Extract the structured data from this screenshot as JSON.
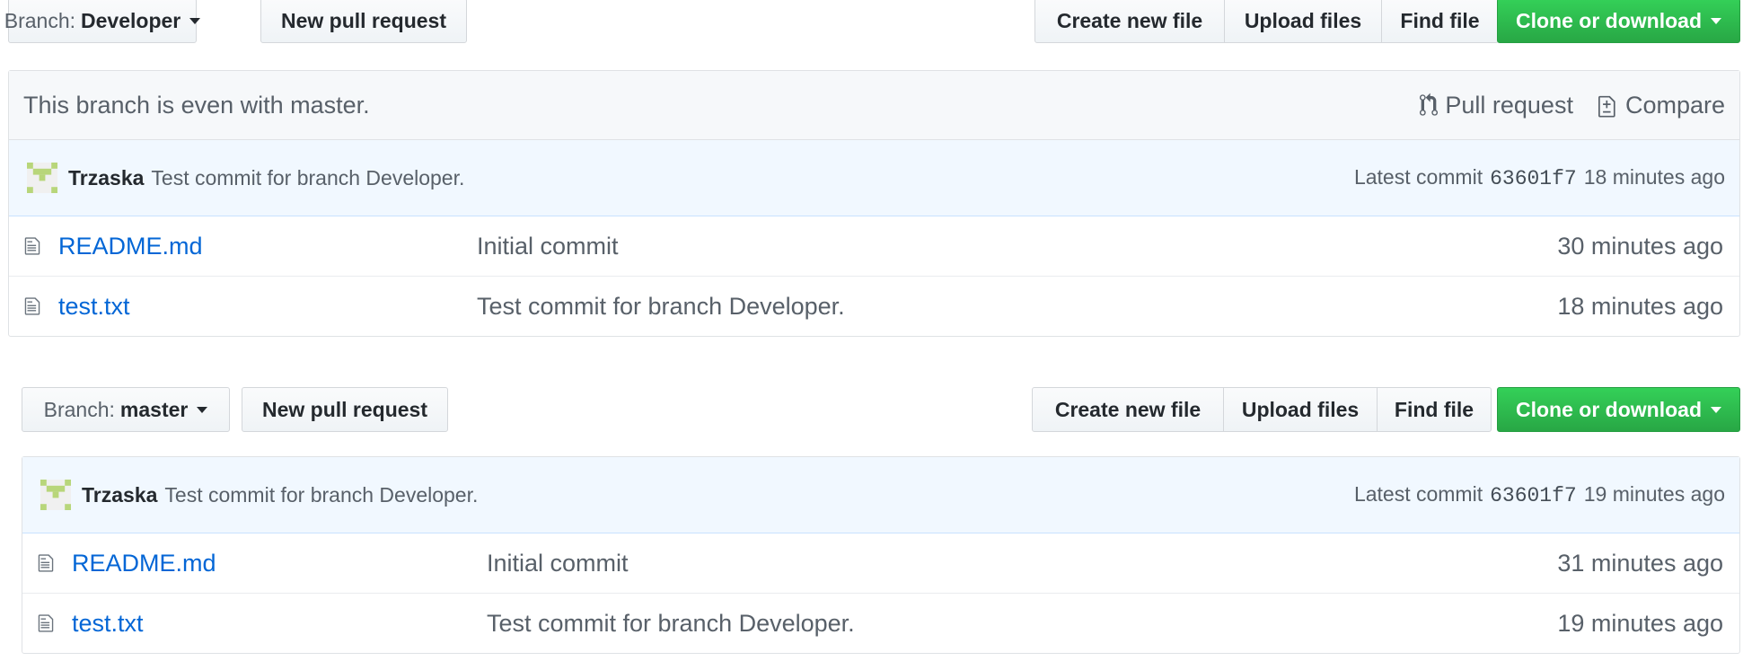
{
  "sections": [
    {
      "branch_label": "Branch:",
      "branch_name": "Developer",
      "new_pr_label": "New pull request",
      "create_file_label": "Create new file",
      "upload_label": "Upload files",
      "find_label": "Find file",
      "clone_label": "Clone or download",
      "compare_text": "This branch is even with master.",
      "pull_request_link": "Pull request",
      "compare_link": "Compare",
      "commit": {
        "author": "Trzaska",
        "message": "Test commit for branch Developer.",
        "latest_label": "Latest commit",
        "sha": "63601f7",
        "age": "18 minutes ago"
      },
      "files": [
        {
          "name": "README.md",
          "message": "Initial commit",
          "age": "30 minutes ago"
        },
        {
          "name": "test.txt",
          "message": "Test commit for branch Developer.",
          "age": "18 minutes ago"
        }
      ]
    },
    {
      "branch_label": "Branch:",
      "branch_name": "master",
      "new_pr_label": "New pull request",
      "create_file_label": "Create new file",
      "upload_label": "Upload files",
      "find_label": "Find file",
      "clone_label": "Clone or download",
      "commit": {
        "author": "Trzaska",
        "message": "Test commit for branch Developer.",
        "latest_label": "Latest commit",
        "sha": "63601f7",
        "age": "19 minutes ago"
      },
      "files": [
        {
          "name": "README.md",
          "message": "Initial commit",
          "age": "31 minutes ago"
        },
        {
          "name": "test.txt",
          "message": "Test commit for branch Developer.",
          "age": "19 minutes ago"
        }
      ]
    }
  ],
  "icons": {
    "file": "file-text-icon",
    "pull_request": "git-pull-request-icon",
    "compare": "diff-icon",
    "avatar": "identicon-avatar",
    "dropdown": "triangle-down-icon"
  },
  "colors": {
    "link": "#0366d6",
    "green_button": "#28a745",
    "commit_bar_bg": "#f1f8ff",
    "muted_text": "#586069"
  }
}
